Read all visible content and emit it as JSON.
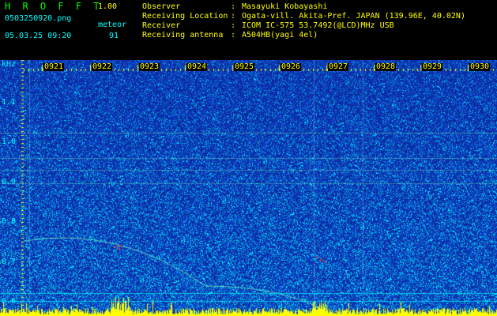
{
  "app": {
    "logo": "H R O F F T",
    "version": "1.00",
    "filename": "0503250920.png",
    "mode": "meteor",
    "datetime": "05.03.25 09:20",
    "count": "91"
  },
  "info": [
    {
      "label": "Observer",
      "value": "Masayuki Kobayashi"
    },
    {
      "label": "Receiving Location",
      "value": "Ogata-vill. Akita-Pref. JAPAN (139.96E, 40.02N)"
    },
    {
      "label": "Receiver",
      "value": "ICOM IC-575 53.7492(@LCD)MHz USB"
    },
    {
      "label": "Receiving antenna",
      "value": "A504HB(yagi 4el)"
    }
  ],
  "spectrogram": {
    "y_unit": "kHz",
    "y_ticks": [
      "1.1",
      "1.0",
      "0.9",
      "0.8",
      "0.7",
      "0.6"
    ],
    "x_ticks": [
      "0921",
      "0922",
      "0923",
      "0924",
      "0925",
      "0926",
      "0927",
      "0928",
      "0929",
      "0930"
    ],
    "colors": {
      "background": "#0a1a8c",
      "noise_mid": "#1e4fd8",
      "noise_hi": "#00c8ff",
      "bars": "#ffff00",
      "ticks": "#ffff00",
      "labels": "#00ffff"
    }
  }
}
